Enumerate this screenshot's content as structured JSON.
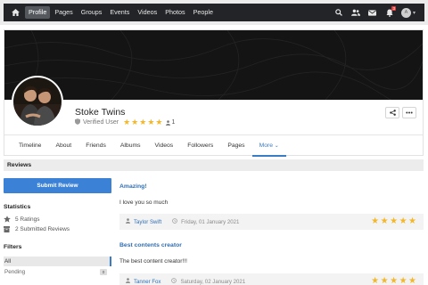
{
  "nav": {
    "links": [
      {
        "label": "Profile",
        "active": true
      },
      {
        "label": "Pages",
        "active": false
      },
      {
        "label": "Groups",
        "active": false
      },
      {
        "label": "Events",
        "active": false
      },
      {
        "label": "Videos",
        "active": false
      },
      {
        "label": "Photos",
        "active": false
      },
      {
        "label": "People",
        "active": false
      }
    ],
    "right_icons": [
      "search-icon",
      "users-icon",
      "envelope-icon",
      "bell-icon"
    ],
    "notification_count": "3",
    "avatar_initial": "A"
  },
  "profile": {
    "name": "Stoke Twins",
    "verified_label": "Verified User",
    "rating_stars": 5,
    "rating_users": "1",
    "tabs": [
      {
        "label": "Timeline",
        "active": false
      },
      {
        "label": "About",
        "active": false
      },
      {
        "label": "Friends",
        "active": false
      },
      {
        "label": "Albums",
        "active": false
      },
      {
        "label": "Videos",
        "active": false
      },
      {
        "label": "Followers",
        "active": false
      },
      {
        "label": "Pages",
        "active": false
      },
      {
        "label": "More",
        "active": true
      }
    ]
  },
  "reviews_section": {
    "title": "Reviews",
    "submit_label": "Submit Review",
    "statistics_title": "Statistics",
    "ratings_count": "5 Ratings",
    "submitted_count": "2 Submitted Reviews",
    "filters_title": "Filters",
    "filter_all": "All",
    "filter_pending": "Pending",
    "pending_count": "0"
  },
  "reviews": [
    {
      "title": "Amazing!",
      "body": "I love you so much",
      "author": "Taylor Swift",
      "date": "Friday, 01 January 2021",
      "stars": 5
    },
    {
      "title": "Best contents creator",
      "body": "The best content creator!!!",
      "author": "Tanner Fox",
      "date": "Saturday, 02 January 2021",
      "stars": 5
    }
  ],
  "colors": {
    "accent": "#3a7cc5",
    "star": "#f3b72a",
    "navbar": "#222427"
  }
}
